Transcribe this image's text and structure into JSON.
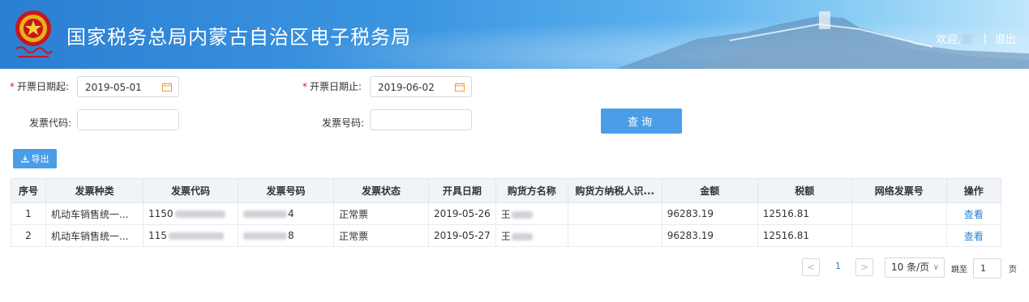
{
  "header": {
    "title": "国家税务总局内蒙古自治区电子税务局",
    "welcome": "欢迎,",
    "separator": "|",
    "logout": "退出"
  },
  "form": {
    "start_date_label": "开票日期起:",
    "start_date_value": "2019-05-01",
    "end_date_label": "开票日期止:",
    "end_date_value": "2019-06-02",
    "invoice_code_label": "发票代码:",
    "invoice_code_value": "",
    "invoice_number_label": "发票号码:",
    "invoice_number_value": "",
    "required_mark": "*",
    "query_button": "查询",
    "export_button": "导出"
  },
  "table": {
    "columns": [
      "序号",
      "发票种类",
      "发票代码",
      "发票号码",
      "发票状态",
      "开具日期",
      "购货方名称",
      "购货方纳税人识...",
      "金额",
      "税额",
      "网络发票号",
      "操作"
    ],
    "rows": [
      {
        "index": "1",
        "type": "机动车销售统一...",
        "code": "1150",
        "number": "4",
        "status": "正常票",
        "date": "2019-05-26",
        "buyer": "王",
        "buyer_tax_id": "",
        "amount": "96283.19",
        "tax": "12516.81",
        "net_invoice_no": "",
        "action": "查看"
      },
      {
        "index": "2",
        "type": "机动车销售统一...",
        "code": "115",
        "number": "8",
        "status": "正常票",
        "date": "2019-05-27",
        "buyer": "王",
        "buyer_tax_id": "",
        "amount": "96283.19",
        "tax": "12516.81",
        "net_invoice_no": "",
        "action": "查看"
      }
    ]
  },
  "pagination": {
    "prev": "<",
    "current_page": "1",
    "next": ">",
    "page_size": "10 条/页",
    "jump_label": "跳至",
    "jump_value": "1",
    "page_unit": "页"
  },
  "colors": {
    "accent": "#4a9ee8",
    "link": "#2a7fd4",
    "required": "#e02020",
    "header_bg": "#3b95e0"
  }
}
